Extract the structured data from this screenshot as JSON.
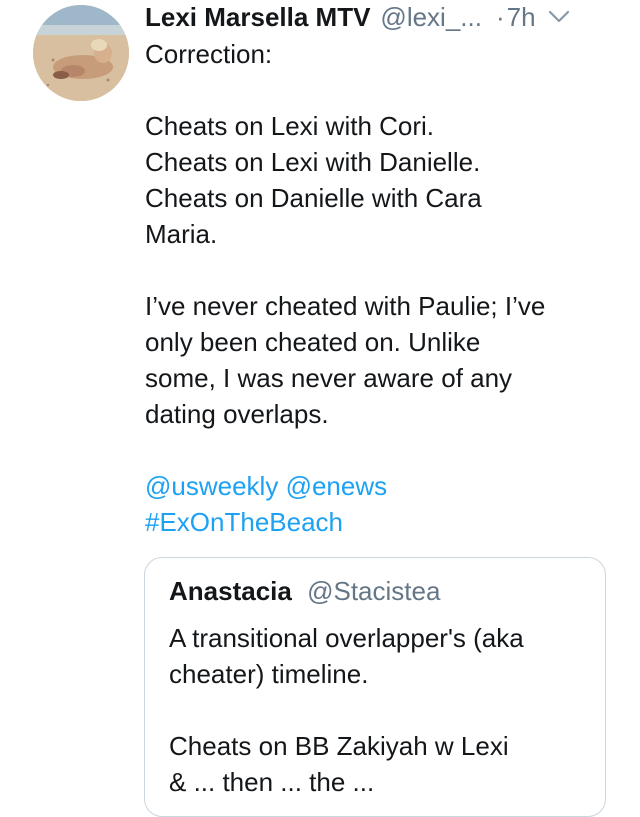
{
  "tweet": {
    "display_name": "Lexi Marsella MTV",
    "handle": "@lexi_...",
    "separator": "·",
    "time": "7h",
    "menu_icon": "chevron-down-icon",
    "lines": [
      "Correction:",
      "",
      "Cheats on Lexi with Cori.",
      "Cheats on Lexi with Danielle.",
      "Cheats on Danielle with Cara",
      "Maria.",
      "",
      "I’ve never cheated with Paulie; I’ve",
      "only been cheated on. Unlike",
      "some, I was never aware of any",
      "dating overlaps.",
      ""
    ],
    "mention_1": "@usweekly",
    "mention_2": "@enews",
    "hashtag": "#ExOnTheBeach"
  },
  "quoted_tweet": {
    "display_name": "Anastacia",
    "handle": "@Stacistea",
    "lines": [
      "A transitional overlapper's (aka",
      "cheater) timeline.",
      "",
      "Cheats on BB Zakiyah w Lexi",
      "& ... then ... the ..."
    ]
  },
  "colors": {
    "link": "#1da1f2",
    "secondary_text": "#657786",
    "primary_text": "#14171a",
    "border": "#ccd6dd"
  }
}
